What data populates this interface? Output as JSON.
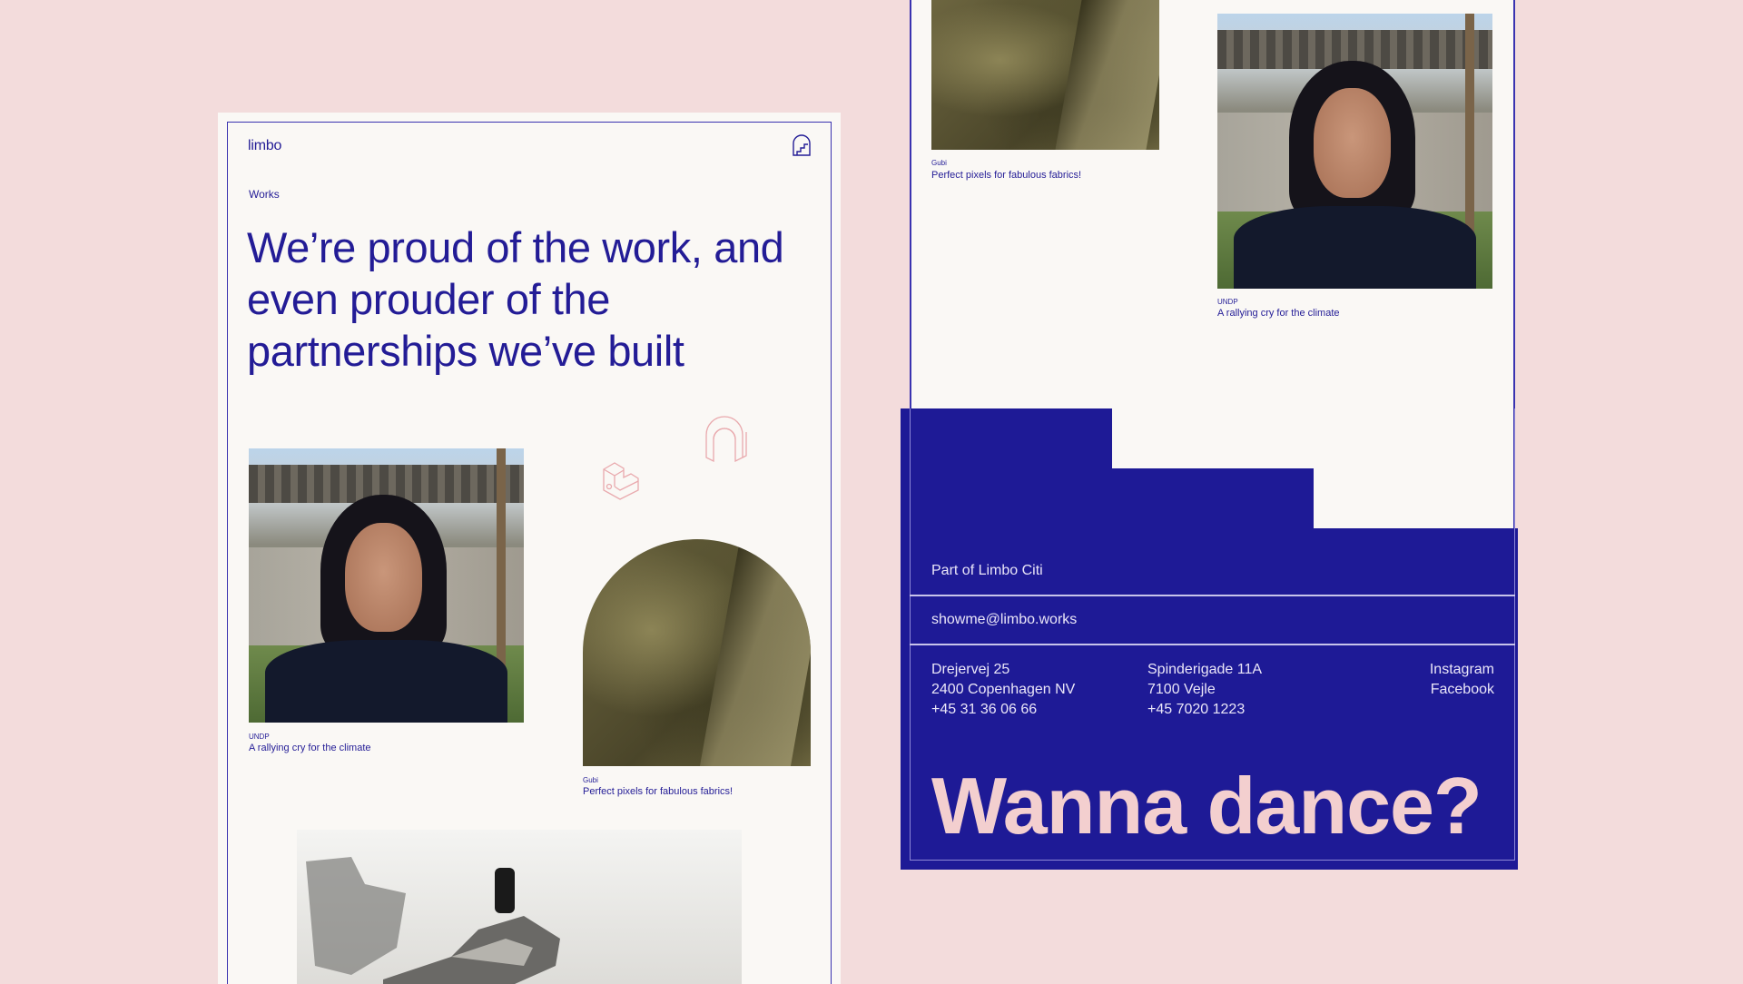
{
  "colors": {
    "background": "#f3dcdc",
    "paper": "#faf8f5",
    "brand_blue": "#1e1a96",
    "cta_pink": "#f3cfcf"
  },
  "left_page": {
    "logo": "limbo",
    "menu_icon": "stairs-menu-icon",
    "breadcrumb": "Works",
    "headline": "We’re proud of the work, and even prouder of the partnerships we’ve built",
    "works": [
      {
        "client": "UNDP",
        "title": "A rallying cry for the climate"
      },
      {
        "client": "Gubi",
        "title": "Perfect pixels for fabulous fabrics!"
      }
    ]
  },
  "right_page": {
    "works": [
      {
        "client": "Gubi",
        "title": "Perfect pixels for fabulous fabrics!"
      },
      {
        "client": "UNDP",
        "title": "A rallying cry for the climate"
      }
    ],
    "footer": {
      "part_of": "Part of Limbo Citi",
      "email": "showme@limbo.works",
      "address_1": {
        "street": "Drejervej 25",
        "city": "2400 Copenhagen NV",
        "phone": "+45 31 36 06 66"
      },
      "address_2": {
        "street": "Spinderigade 11A",
        "city": "7100 Vejle",
        "phone": "+45 7020 1223"
      },
      "social": [
        "Instagram",
        "Facebook"
      ],
      "cta": "Wanna dance?"
    }
  }
}
